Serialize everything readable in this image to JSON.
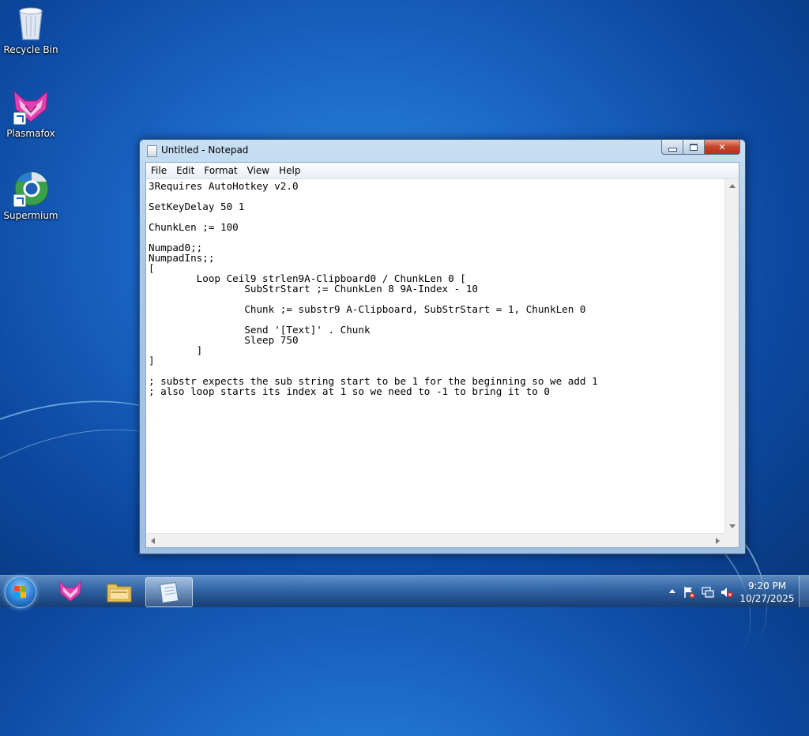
{
  "desktop": {
    "icons": [
      {
        "label": "Recycle Bin",
        "icon": "recycle-bin-icon"
      },
      {
        "label": "Plasmafox",
        "icon": "plasmafox-icon"
      },
      {
        "label": "Supermium",
        "icon": "supermium-icon"
      }
    ]
  },
  "notepad": {
    "title": "Untitled - Notepad",
    "menu": [
      "File",
      "Edit",
      "Format",
      "View",
      "Help"
    ],
    "content": "3Requires AutoHotkey v2.0\n\nSetKeyDelay 50 1\n\nChunkLen ;= 100\n\nNumpad0;;\nNumpadIns;;\n[\n        Loop Ceil9 strlen9A-Clipboard0 / ChunkLen 0 [\n                SubStrStart ;= ChunkLen 8 9A-Index - 10\n\n                Chunk ;= substr9 A-Clipboard, SubStrStart = 1, ChunkLen 0\n\n                Send '[Text]' . Chunk\n                Sleep 750\n        ]\n]\n\n; substr expects the sub string start to be 1 for the beginning so we add 1\n; also loop starts its index at 1 so we need to -1 to bring it to 0"
  },
  "taskbar": {
    "pinned": [
      "plasmafox-icon",
      "file-explorer-icon",
      "notepad-icon"
    ],
    "active": "notepad-icon",
    "clock": {
      "time": "9:20 PM",
      "date": "10/27/2025"
    },
    "tray_icons": [
      "show-hidden-icons-arrow",
      "action-center-flag-icon",
      "network-icon",
      "volume-muted-icon"
    ]
  },
  "colors": {
    "wallpaper": "#1b66c6",
    "title_bar": "#b7cfe9",
    "close_button": "#c7432a"
  }
}
